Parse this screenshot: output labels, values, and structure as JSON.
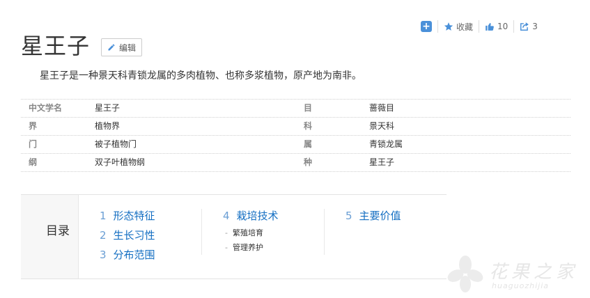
{
  "toolbar": {
    "add_symbol": "+",
    "collect_label": "收藏",
    "like_count": "10",
    "share_count": "3"
  },
  "title": "星王子",
  "edit_label": "编辑",
  "summary": "星王子是一种景天科青锁龙属的多肉植物、也称多浆植物，原产地为南非。",
  "basic_info": [
    {
      "k1": "中文学名",
      "v1": "星王子",
      "k2": "目",
      "v2": "蔷薇目"
    },
    {
      "k1": "界",
      "v1": "植物界",
      "k2": "科",
      "v2": "景天科"
    },
    {
      "k1": "门",
      "v1": "被子植物门",
      "k2": "属",
      "v2": "青锁龙属"
    },
    {
      "k1": "纲",
      "v1": "双子叶植物纲",
      "k2": "种",
      "v2": "星王子"
    }
  ],
  "toc": {
    "heading": "目录",
    "col1": [
      {
        "num": "1",
        "label": "形态特征"
      },
      {
        "num": "2",
        "label": "生长习性"
      },
      {
        "num": "3",
        "label": "分布范围"
      }
    ],
    "col2": {
      "item": {
        "num": "4",
        "label": "栽培技术"
      },
      "subs": [
        "繁殖培育",
        "管理养护"
      ]
    },
    "col3": [
      {
        "num": "5",
        "label": "主要价值"
      }
    ]
  },
  "watermark": {
    "text": "花果之家",
    "sub": "huaguozhijia"
  },
  "colors": {
    "link": "#136ec2",
    "accent": "#4a90d9"
  }
}
